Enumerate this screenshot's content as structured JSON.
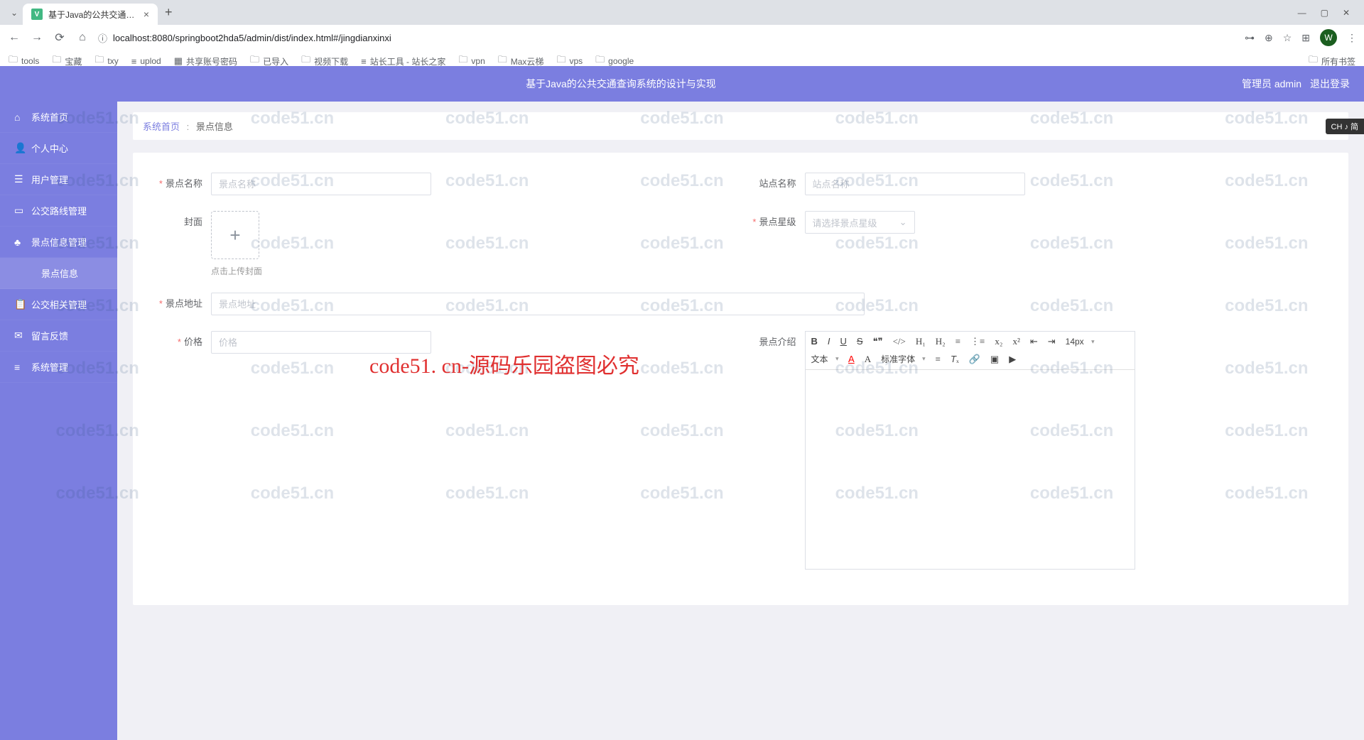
{
  "browser": {
    "tab_title": "基于Java的公共交通查询系",
    "url": "localhost:8080/springboot2hda5/admin/dist/index.html#/jingdianxinxi",
    "profile_initial": "W",
    "bookmarks": [
      "tools",
      "宝藏",
      "txy",
      "uplod",
      "共享账号密码",
      "已导入",
      "视频下载",
      "站长工具 - 站长之家",
      "vpn",
      "Max云梯",
      "vps",
      "google"
    ],
    "bookmarks_right": "所有书签"
  },
  "header": {
    "title": "基于Java的公共交通查询系统的设计与实现",
    "user_label": "管理员 admin",
    "logout": "退出登录"
  },
  "sidebar": {
    "items": [
      {
        "icon": "⌂",
        "label": "系统首页"
      },
      {
        "icon": "👤",
        "label": "个人中心"
      },
      {
        "icon": "☰",
        "label": "用户管理"
      },
      {
        "icon": "▭",
        "label": "公交路线管理"
      },
      {
        "icon": "♣",
        "label": "景点信息管理"
      },
      {
        "icon": "",
        "label": "景点信息",
        "sub": true
      },
      {
        "icon": "📋",
        "label": "公交相关管理"
      },
      {
        "icon": "✉",
        "label": "留言反馈"
      },
      {
        "icon": "≡",
        "label": "系统管理"
      }
    ]
  },
  "breadcrumb": {
    "home": "系统首页",
    "current": "景点信息"
  },
  "form": {
    "name_label": "景点名称",
    "name_ph": "景点名称",
    "station_label": "站点名称",
    "station_ph": "站点名称",
    "cover_label": "封面",
    "upload_hint": "点击上传封面",
    "star_label": "景点星级",
    "star_ph": "请选择景点星级",
    "addr_label": "景点地址",
    "addr_ph": "景点地址",
    "price_label": "价格",
    "price_ph": "价格",
    "intro_label": "景点介绍"
  },
  "editor": {
    "font_size": "14px",
    "text_type": "文本",
    "font_family": "标准字体"
  },
  "ime": "CH ♪ 简",
  "watermark": "code51.cn",
  "overlay": "code51. cn-源码乐园盗图必究"
}
